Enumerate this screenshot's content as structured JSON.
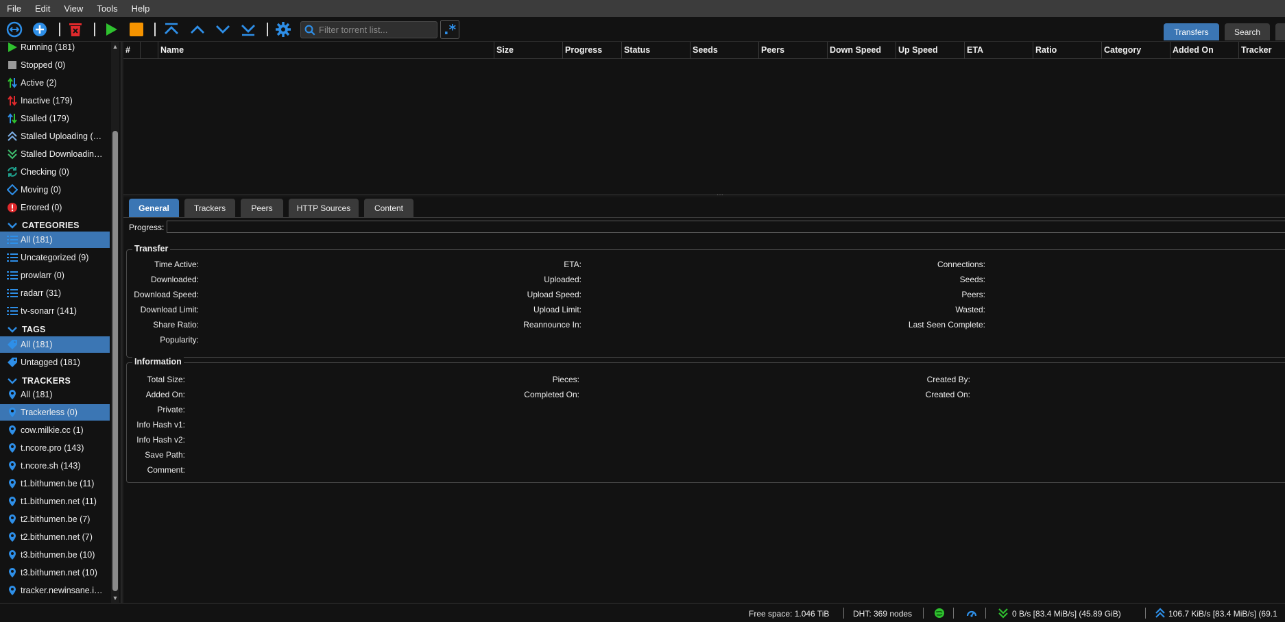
{
  "menu": [
    "File",
    "Edit",
    "View",
    "Tools",
    "Help"
  ],
  "toolbar": {
    "search_placeholder": "Filter torrent list...",
    "regex_label": ".*",
    "tabs": [
      {
        "label": "Transfers",
        "active": true
      },
      {
        "label": "Search",
        "active": false
      }
    ]
  },
  "sidebar": {
    "status_items": [
      {
        "label": "Running (181)",
        "icon": "play-icon"
      },
      {
        "label": "Stopped (0)",
        "icon": "stop-icon"
      },
      {
        "label": "Active (2)",
        "icon": "active-arrows-icon"
      },
      {
        "label": "Inactive (179)",
        "icon": "inactive-arrows-icon"
      },
      {
        "label": "Stalled (179)",
        "icon": "stalled-arrows-icon"
      },
      {
        "label": "Stalled Uploading (1…",
        "icon": "stalled-uploading-icon"
      },
      {
        "label": "Stalled Downloading…",
        "icon": "stalled-downloading-icon"
      },
      {
        "label": "Checking (0)",
        "icon": "checking-icon"
      },
      {
        "label": "Moving (0)",
        "icon": "moving-icon"
      },
      {
        "label": "Errored (0)",
        "icon": "error-icon"
      }
    ],
    "categories_header": "CATEGORIES",
    "categories": [
      {
        "label": "All (181)",
        "selected": true
      },
      {
        "label": "Uncategorized (9)",
        "selected": false
      },
      {
        "label": "prowlarr (0)",
        "selected": false
      },
      {
        "label": "radarr (31)",
        "selected": false
      },
      {
        "label": "tv-sonarr (141)",
        "selected": false
      }
    ],
    "tags_header": "TAGS",
    "tags": [
      {
        "label": "All (181)",
        "selected": true
      },
      {
        "label": "Untagged (181)",
        "selected": false
      }
    ],
    "trackers_header": "TRACKERS",
    "trackers": [
      {
        "label": "All (181)",
        "selected": false
      },
      {
        "label": "Trackerless (0)",
        "selected": true
      },
      {
        "label": "cow.milkie.cc (1)",
        "selected": false
      },
      {
        "label": "t.ncore.pro (143)",
        "selected": false
      },
      {
        "label": "t.ncore.sh (143)",
        "selected": false
      },
      {
        "label": "t1.bithumen.be (11)",
        "selected": false
      },
      {
        "label": "t1.bithumen.net (11)",
        "selected": false
      },
      {
        "label": "t2.bithumen.be (7)",
        "selected": false
      },
      {
        "label": "t2.bithumen.net (7)",
        "selected": false
      },
      {
        "label": "t3.bithumen.be (10)",
        "selected": false
      },
      {
        "label": "t3.bithumen.net (10)",
        "selected": false
      },
      {
        "label": "tracker.newinsane.in…",
        "selected": false
      }
    ]
  },
  "table": {
    "columns": [
      "#",
      "",
      "Name",
      "Size",
      "Progress",
      "Status",
      "Seeds",
      "Peers",
      "Down Speed",
      "Up Speed",
      "ETA",
      "Ratio",
      "Category",
      "Added On",
      "Tracker"
    ]
  },
  "details": {
    "tabs": [
      "General",
      "Trackers",
      "Peers",
      "HTTP Sources",
      "Content"
    ],
    "progress_label": "Progress:",
    "transfer_title": "Transfer",
    "transfer_col1": [
      "Time Active:",
      "Downloaded:",
      "Download Speed:",
      "Download Limit:",
      "Share Ratio:",
      "Popularity:"
    ],
    "transfer_col2": [
      "ETA:",
      "Uploaded:",
      "Upload Speed:",
      "Upload Limit:",
      "Reannounce In:"
    ],
    "transfer_col3": [
      "Connections:",
      "Seeds:",
      "Peers:",
      "Wasted:",
      "Last Seen Complete:"
    ],
    "information_title": "Information",
    "info_col1": [
      "Total Size:",
      "Added On:",
      "Private:",
      "Info Hash v1:",
      "Info Hash v2:",
      "Save Path:",
      "Comment:"
    ],
    "info_col2": [
      "Pieces:",
      "Completed On:"
    ],
    "info_col3": [
      "Created By:",
      "Created On:"
    ]
  },
  "status": {
    "free_space": "Free space: 1.046 TiB",
    "dht": "DHT: 369 nodes",
    "download": "0 B/s [83.4 MiB/s] (45.89 GiB)",
    "upload": "106.7 KiB/s [83.4 MiB/s] (69.1"
  },
  "colors": {
    "accent": "#3b76b4",
    "menubar": "#3c3c3c",
    "background": "#121212",
    "icon_blue": "#2e8fe8",
    "play_green": "#2fc12f",
    "stop_orange": "#f59300",
    "delete_red": "#e0292c"
  }
}
